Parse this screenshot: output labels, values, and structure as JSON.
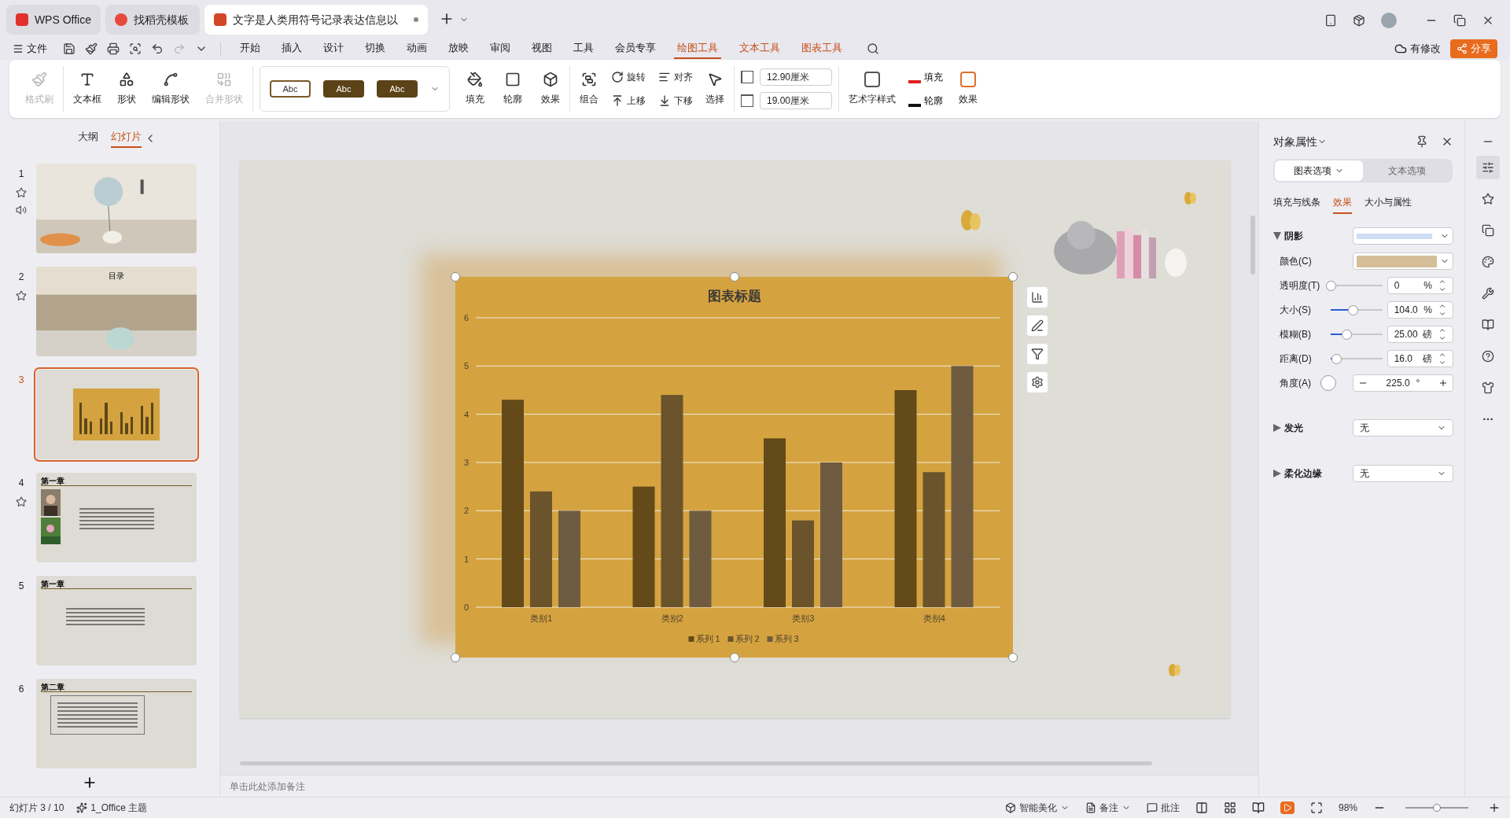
{
  "browser_tabs": [
    {
      "label": "WPS Office",
      "selected": false,
      "kind": "wps"
    },
    {
      "label": "找稻壳模板",
      "selected": false,
      "kind": "docer"
    },
    {
      "label": "文字是人类用符号记录表达信息以",
      "selected": true,
      "kind": "ppt",
      "modified": true
    }
  ],
  "menu": {
    "file": "文件",
    "tabs": [
      {
        "label": "开始",
        "selected": false,
        "kind": "normal"
      },
      {
        "label": "插入",
        "selected": false,
        "kind": "normal"
      },
      {
        "label": "设计",
        "selected": false,
        "kind": "normal"
      },
      {
        "label": "切换",
        "selected": false,
        "kind": "normal"
      },
      {
        "label": "动画",
        "selected": false,
        "kind": "normal"
      },
      {
        "label": "放映",
        "selected": false,
        "kind": "normal"
      },
      {
        "label": "审阅",
        "selected": false,
        "kind": "normal"
      },
      {
        "label": "视图",
        "selected": false,
        "kind": "normal"
      },
      {
        "label": "工具",
        "selected": false,
        "kind": "normal"
      },
      {
        "label": "会员专享",
        "selected": false,
        "kind": "normal"
      },
      {
        "label": "绘图工具",
        "selected": true,
        "kind": "context"
      },
      {
        "label": "文本工具",
        "selected": false,
        "kind": "context"
      },
      {
        "label": "图表工具",
        "selected": false,
        "kind": "context"
      }
    ],
    "changes": "有修改",
    "share": "分享"
  },
  "ribbon": {
    "format_painter": {
      "label": "格式刷",
      "disabled": true
    },
    "shape_tools": [
      {
        "label": "文本框",
        "disabled": false
      },
      {
        "label": "形状",
        "disabled": false
      },
      {
        "label": "编辑形状",
        "disabled": false
      },
      {
        "label": "合并形状",
        "disabled": true
      }
    ],
    "style_presets": [
      {
        "label": "Abc",
        "kind": "outline"
      },
      {
        "label": "Abc",
        "kind": "filled"
      },
      {
        "label": "Abc",
        "kind": "filled"
      }
    ],
    "shape_format": [
      {
        "label": "填充"
      },
      {
        "label": "轮廓"
      },
      {
        "label": "效果"
      }
    ],
    "arrange_large": {
      "label": "组合"
    },
    "arrange_small": [
      {
        "label": "旋转"
      },
      {
        "label": "对齐"
      },
      {
        "label": "上移"
      },
      {
        "label": "下移"
      }
    ],
    "select": {
      "label": "选择"
    },
    "height": "12.90厘米",
    "width": "19.00厘米",
    "wordart": {
      "label": "艺术字样式",
      "fill": "填充",
      "outline": "轮廓",
      "effect": "效果"
    }
  },
  "slides_panel": {
    "tabs": [
      {
        "label": "大纲",
        "selected": false
      },
      {
        "label": "幻灯片",
        "selected": true
      }
    ],
    "slides": [
      {
        "number": "1",
        "selected": false,
        "kind": "cover",
        "starred": true,
        "audio": true
      },
      {
        "number": "2",
        "selected": false,
        "kind": "contents",
        "starred": true,
        "audio": false,
        "heading": "目录"
      },
      {
        "number": "3",
        "selected": true,
        "kind": "chart",
        "starred": false,
        "audio": false
      },
      {
        "number": "4",
        "selected": false,
        "kind": "photo_text",
        "starred": true,
        "audio": false,
        "heading": "第一章"
      },
      {
        "number": "5",
        "selected": false,
        "kind": "text",
        "starred": false,
        "audio": false,
        "heading": "第一章"
      },
      {
        "number": "6",
        "selected": false,
        "kind": "framed_text",
        "starred": false,
        "audio": false,
        "heading": "第二章"
      }
    ]
  },
  "chart": {
    "chart_data": {
      "type": "bar",
      "title": "图表标题",
      "categories": [
        "类别1",
        "类别2",
        "类别3",
        "类别4"
      ],
      "series": [
        {
          "name": "系列 1",
          "color": "#634a18",
          "values": [
            4.3,
            2.5,
            3.5,
            4.5
          ]
        },
        {
          "name": "系列 2",
          "color": "#6b532b",
          "values": [
            2.4,
            4.4,
            1.8,
            2.8
          ]
        },
        {
          "name": "系列 3",
          "color": "#6f5b3f",
          "values": [
            2,
            2,
            3,
            5
          ]
        }
      ],
      "ylim": [
        0,
        6
      ],
      "yticks": [
        {
          "value": 0,
          "label": "0"
        },
        {
          "value": 1,
          "label": "1"
        },
        {
          "value": 2,
          "label": "2"
        },
        {
          "value": 3,
          "label": "3"
        },
        {
          "value": 4,
          "label": "4"
        },
        {
          "value": 5,
          "label": "5"
        },
        {
          "value": 6,
          "label": "6"
        }
      ],
      "grid": true,
      "legend": true
    }
  },
  "properties_panel": {
    "title": "对象属性",
    "mode_tabs": [
      {
        "label": "图表选项",
        "selected": true
      },
      {
        "label": "文本选项",
        "selected": false
      }
    ],
    "sub_tabs": [
      {
        "label": "填充与线条",
        "selected": false
      },
      {
        "label": "效果",
        "selected": true
      },
      {
        "label": "大小与属性",
        "selected": false
      }
    ],
    "shadow": {
      "label": "阴影",
      "expanded": true,
      "color_label": "颜色(C)",
      "color": "#d4bf99",
      "sliders": [
        {
          "label": "透明度(T)",
          "level": 0,
          "value": "0",
          "unit": "%"
        },
        {
          "label": "大小(S)",
          "level": 0.42,
          "value": "104.0",
          "unit": "%"
        },
        {
          "label": "模糊(B)",
          "level": 0.3,
          "value": "25.00",
          "unit": "磅"
        },
        {
          "label": "距离(D)",
          "level": 0.1,
          "value": "16.0",
          "unit": "磅"
        }
      ],
      "angle_label": "角度(A)",
      "angle": "225.0",
      "angle_unit": "°"
    },
    "sections": [
      {
        "label": "发光",
        "expanded": false,
        "value": "无"
      },
      {
        "label": "柔化边缘",
        "expanded": false,
        "value": "无"
      }
    ]
  },
  "notes_placeholder": "单击此处添加备注",
  "status_bar": {
    "slide_info": "幻灯片 3 / 10",
    "theme": "1_Office 主题",
    "beautify": "智能美化",
    "notes": "备注",
    "comments": "批注",
    "zoom": "98%",
    "zoom_slider": {
      "level": 0.5
    }
  }
}
